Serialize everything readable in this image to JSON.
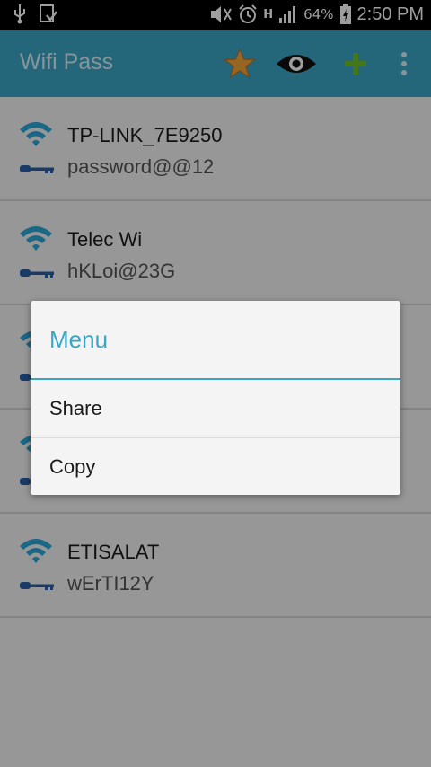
{
  "status_bar": {
    "battery": "64%",
    "time": "2:50 PM",
    "network_letter": "H"
  },
  "action_bar": {
    "title": "Wifi Pass",
    "icons": [
      "star-icon",
      "eye-icon",
      "plus-icon",
      "overflow-menu-icon"
    ]
  },
  "networks": [
    {
      "ssid": "TP-LINK_7E9250",
      "password": "password@@12"
    },
    {
      "ssid": "Telec Wi",
      "password": "hKLoi@23G"
    },
    {
      "ssid": "",
      "password": ""
    },
    {
      "ssid": "",
      "password": ""
    },
    {
      "ssid": "ETISALAT",
      "password": "wErTI12Y"
    }
  ],
  "dialog": {
    "title": "Menu",
    "items": [
      "Share",
      "Copy"
    ]
  },
  "colors": {
    "accent": "#3aa6c5",
    "wifi_icon": "#2ba6d9",
    "key_icon": "#2a5fa8",
    "star": "#f2a43a",
    "plus": "#6fbf2a"
  }
}
